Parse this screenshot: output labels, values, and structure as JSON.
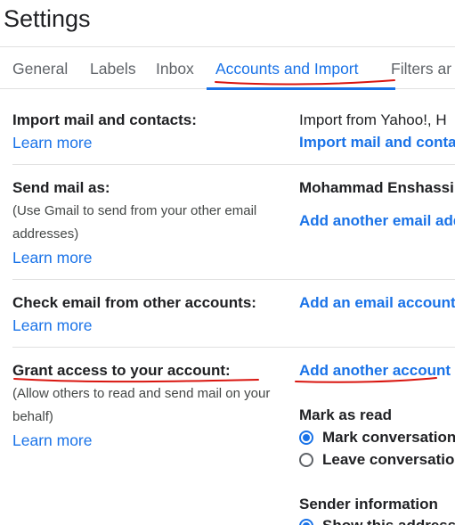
{
  "page": {
    "title": "Settings"
  },
  "tabs": [
    {
      "label": "General"
    },
    {
      "label": "Labels"
    },
    {
      "label": "Inbox"
    },
    {
      "label": "Accounts and Import"
    },
    {
      "label": "Filters ar"
    }
  ],
  "colors": {
    "accent": "#1a73e8",
    "annotation": "#d9150f"
  },
  "import_section": {
    "label": "Import mail and contacts:",
    "learn_more": "Learn more",
    "info_text": "Import from Yahoo!, H",
    "action_link": "Import mail and conta"
  },
  "send_as_section": {
    "label": "Send mail as:",
    "description": "(Use Gmail to send from your other email addresses)",
    "learn_more": "Learn more",
    "account_name": "Mohammad Enshassi",
    "action_link": "Add another email add"
  },
  "check_email_section": {
    "label": "Check email from other accounts:",
    "learn_more": "Learn more",
    "action_link": "Add an email account"
  },
  "grant_access_section": {
    "label": "Grant access to your account:",
    "description": "(Allow others to read and send mail on your behalf)",
    "learn_more": "Learn more",
    "action_link": "Add another account",
    "mark_as_read": {
      "heading": "Mark as read",
      "options": [
        {
          "label": "Mark conversation",
          "checked": true
        },
        {
          "label": "Leave conversatio",
          "checked": false
        }
      ]
    },
    "sender_information": {
      "heading": "Sender information",
      "options": [
        {
          "label": "Show this address",
          "checked": true
        }
      ]
    }
  }
}
